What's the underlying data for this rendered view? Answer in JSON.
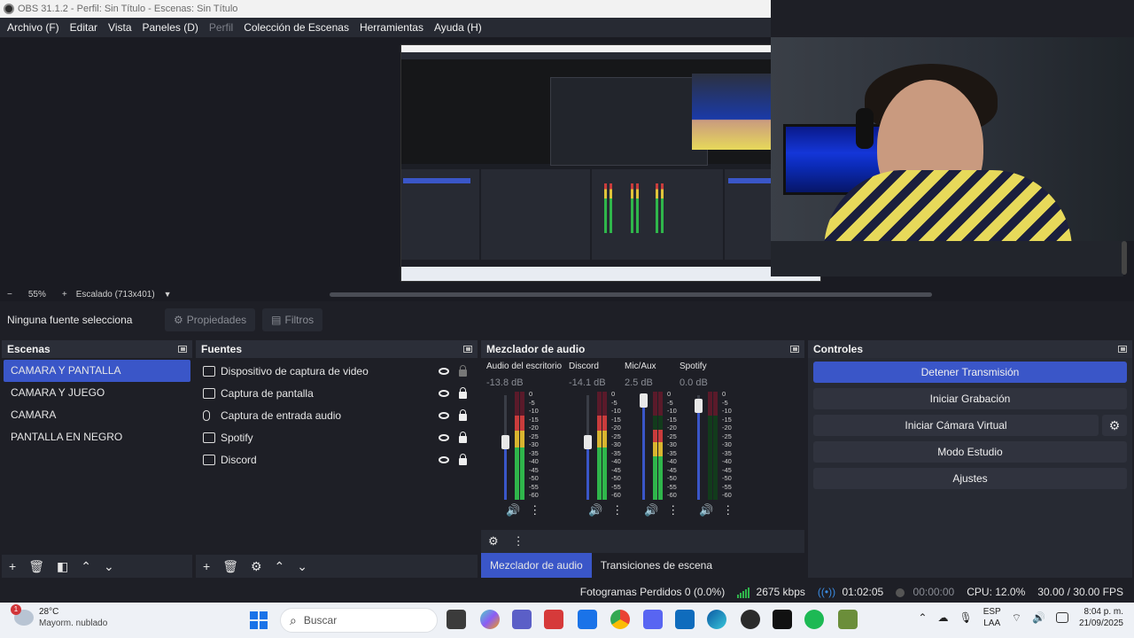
{
  "window": {
    "title": "OBS 31.1.2 - Perfil: Sin Título - Escenas: Sin Título"
  },
  "menu": [
    {
      "label": "Archivo (F)",
      "disabled": false
    },
    {
      "label": "Editar",
      "disabled": false
    },
    {
      "label": "Vista",
      "disabled": false
    },
    {
      "label": "Paneles (D)",
      "disabled": false
    },
    {
      "label": "Perfil",
      "disabled": true
    },
    {
      "label": "Colección de Escenas",
      "disabled": false
    },
    {
      "label": "Herramientas",
      "disabled": false
    },
    {
      "label": "Ayuda (H)",
      "disabled": false
    }
  ],
  "zoom": {
    "minus": "−",
    "level": "55%",
    "plus": "+",
    "mode": "Escalado (713x401)"
  },
  "source_toolbar": {
    "no_source": "Ninguna fuente selecciona",
    "properties": "Propiedades",
    "filters": "Filtros"
  },
  "scenes": {
    "title": "Escenas",
    "items": [
      "CAMARA Y PANTALLA",
      "CAMARA Y JUEGO",
      "CAMARA",
      "PANTALLA EN NEGRO"
    ],
    "active": 0
  },
  "sources": {
    "title": "Fuentes",
    "items": [
      {
        "label": "Dispositivo de captura de video",
        "icon": "camera-icon",
        "locked": false
      },
      {
        "label": "Captura de pantalla",
        "icon": "monitor-icon",
        "locked": true
      },
      {
        "label": "Captura de entrada audio",
        "icon": "microphone-icon",
        "locked": true
      },
      {
        "label": "Spotify",
        "icon": "window-icon",
        "locked": true
      },
      {
        "label": "Discord",
        "icon": "window-icon",
        "locked": true
      }
    ]
  },
  "mixer": {
    "title": "Mezclador de audio",
    "channels": [
      {
        "name": "Audio del escritorio",
        "db": "-13.8 dB",
        "fader": 0.55,
        "level": 0.78
      },
      {
        "name": "Discord",
        "db": "-14.1 dB",
        "fader": 0.55,
        "level": 0.78
      },
      {
        "name": "Mic/Aux",
        "db": "2.5 dB",
        "fader": 0.95,
        "level": 0.65
      },
      {
        "name": "Spotify",
        "db": "0.0 dB",
        "fader": 0.9,
        "level": 0.0
      }
    ],
    "scale": [
      "0",
      "-5",
      "-10",
      "-15",
      "-20",
      "-25",
      "-30",
      "-35",
      "-40",
      "-45",
      "-50",
      "-55",
      "-60"
    ],
    "tabs": [
      "Mezclador de audio",
      "Transiciones de escena"
    ]
  },
  "controls": {
    "title": "Controles",
    "stop_stream": "Detener Transmisión",
    "start_recording": "Iniciar Grabación",
    "virtual_camera": "Iniciar Cámara Virtual",
    "studio_mode": "Modo Estudio",
    "settings": "Ajustes"
  },
  "status": {
    "dropped_frames": "Fotogramas Perdidos 0 (0.0%)",
    "bitrate": "2675 kbps",
    "stream_time": "01:02:05",
    "rec_time": "00:00:00",
    "cpu": "CPU: 12.0%",
    "fps": "30.00 / 30.00 FPS"
  },
  "taskbar": {
    "weather_temp": "28°C",
    "weather_cond": "Mayorm. nublado",
    "weather_badge": "1",
    "search_placeholder": "Buscar",
    "lang_1": "ESP",
    "lang_2": "LAA",
    "time": "8:04 p. m.",
    "date": "21/09/2025"
  },
  "colors": {
    "accent": "#3a56c8",
    "meter_green": "#2fb64b",
    "meter_yellow": "#d9b52f",
    "meter_red": "#c93c3c"
  }
}
